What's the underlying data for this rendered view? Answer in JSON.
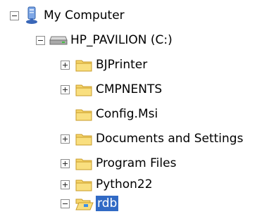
{
  "tree": {
    "root": {
      "label": "My Computer",
      "icon": "my-computer-icon",
      "expanded": true
    },
    "drive": {
      "label": "HP_PAVILION (C:)",
      "icon": "hard-drive-icon",
      "expanded": true
    },
    "folders": [
      {
        "label": "BJPrinter",
        "expander": "plus",
        "icon": "folder-icon"
      },
      {
        "label": "CMPNENTS",
        "expander": "plus",
        "icon": "folder-icon"
      },
      {
        "label": "Config.Msi",
        "expander": "none",
        "icon": "folder-icon"
      },
      {
        "label": "Documents and Settings",
        "expander": "plus",
        "icon": "folder-icon"
      },
      {
        "label": "Program Files",
        "expander": "plus",
        "icon": "folder-icon"
      },
      {
        "label": "Python22",
        "expander": "plus",
        "icon": "folder-icon"
      },
      {
        "label": "rdb",
        "expander": "minus",
        "icon": "folder-open-icon",
        "selected": true
      }
    ]
  },
  "colors": {
    "selection": "#316ac5",
    "folder_fill": "#f6d56a",
    "folder_edge": "#c89b2a"
  }
}
